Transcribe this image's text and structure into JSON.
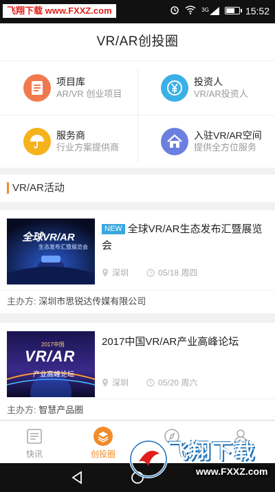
{
  "status_bar": {
    "watermark": "飞翔下载 www.FXXZ.com",
    "network": "3G",
    "time": "15:52"
  },
  "header": {
    "title": "VR/AR创投圈"
  },
  "categories": [
    {
      "title": "项目库",
      "subtitle": "AR/VR 创业项目",
      "icon": "document-icon",
      "color": "#f07a4f"
    },
    {
      "title": "投资人",
      "subtitle": "VR/AR投资人",
      "icon": "yen-icon",
      "color": "#3ab0e6"
    },
    {
      "title": "服务商",
      "subtitle": "行业方案提供商",
      "icon": "umbrella-icon",
      "color": "#f5b21c"
    },
    {
      "title": "入驻VR/AR空间",
      "subtitle": "提供全方位服务",
      "icon": "house-icon",
      "color": "#6b7fe0"
    }
  ],
  "section": {
    "title": "VR/AR活动"
  },
  "events": [
    {
      "badge": "NEW",
      "title": "全球VR/AR生态发布汇暨展览会",
      "location": "深圳",
      "date": "05/18 周四",
      "host_label": "主办方:",
      "host": "深圳市思锐达传媒有限公司",
      "thumb_text": "全球VR/AR",
      "thumb_sub": "生态发布汇暨展览会"
    },
    {
      "badge": "",
      "title": "2017中国VR/AR产业高峰论坛",
      "location": "深圳",
      "date": "05/20 周六",
      "host_label": "主办方:",
      "host": "智慧产品圈",
      "thumb_text": "VR/AR",
      "thumb_sub": "产业高峰论坛",
      "thumb_year": "2017中国"
    }
  ],
  "tabs": [
    {
      "label": "快讯",
      "icon": "news-icon",
      "active": false
    },
    {
      "label": "创投圈",
      "icon": "layers-icon",
      "active": true
    },
    {
      "label": "",
      "icon": "compass-icon",
      "active": false
    },
    {
      "label": "",
      "icon": "user-icon",
      "active": false
    }
  ],
  "watermark_bottom": {
    "text": "飞翔下载",
    "url": "www.FXXZ.com"
  },
  "colors": {
    "accent": "#f08c2a",
    "badge": "#3aa7e0"
  }
}
